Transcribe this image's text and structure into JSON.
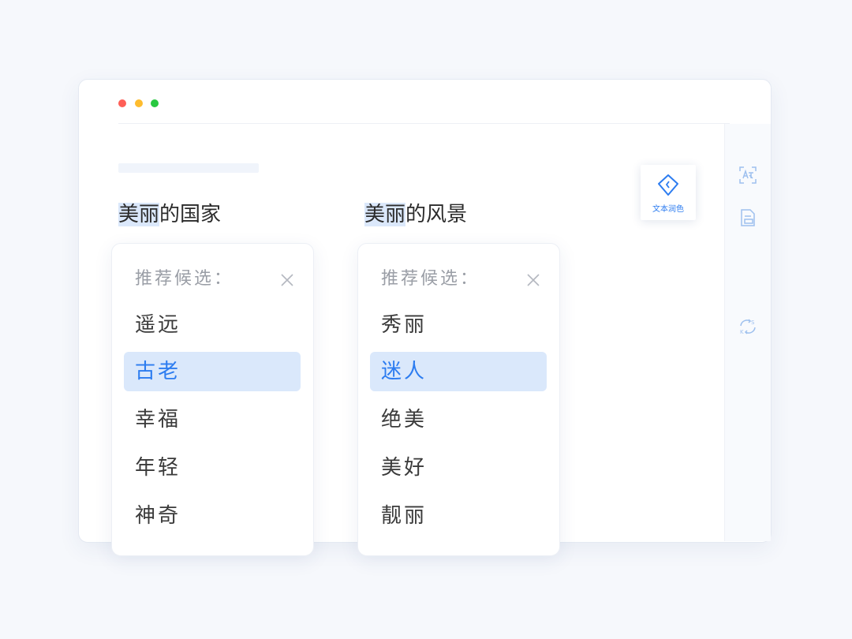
{
  "window": {
    "traffic_lights": [
      "#fe5f57",
      "#febc2e",
      "#28c840"
    ]
  },
  "toolbar": {
    "icons": [
      "translate-icon",
      "document-icon",
      "text-polish-icon",
      "rewrite-icon"
    ],
    "active_label": "文本润色",
    "accent": "#2c7cf0"
  },
  "editor": {
    "phrases": [
      {
        "highlight": "美丽",
        "rest": "的国家"
      },
      {
        "highlight": "美丽",
        "rest": "的风景"
      }
    ]
  },
  "popups": [
    {
      "title": "推荐候选：",
      "candidates": [
        "遥远",
        "古老",
        "幸福",
        "年轻",
        "神奇"
      ],
      "selected_index": 1
    },
    {
      "title": "推荐候选：",
      "candidates": [
        "秀丽",
        "迷人",
        "绝美",
        "美好",
        "靓丽"
      ],
      "selected_index": 1
    }
  ]
}
